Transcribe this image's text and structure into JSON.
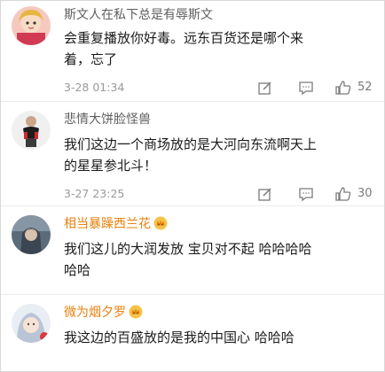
{
  "comments": [
    {
      "username": "斯文人在私下总是有辱斯文",
      "text_line1": "会重复播放你好毒。远东百货还是哪个来",
      "text_line2": "着，忘了",
      "time": "3-28 01:34",
      "likes": "52",
      "vip": false
    },
    {
      "username": "悲情大饼脸怪兽",
      "text_line1": "我们这边一个商场放的是大河向东流啊天上",
      "text_line2": "的星星参北斗！",
      "time": "3-27 23:25",
      "likes": "30",
      "vip": false
    },
    {
      "username": "相当暴躁西兰花",
      "text_line1": "我们这儿的大润发放  宝贝对不起  哈哈哈哈",
      "text_line2": "哈哈",
      "vip": true
    },
    {
      "username": "微为烟夕罗",
      "text_line1": "我这边的百盛放的是我的中国心 哈哈哈",
      "vip": true
    }
  ],
  "icons": {
    "edit": "edit-icon",
    "comment": "comment-icon",
    "like": "thumbs-up-icon",
    "crown": "crown-emoji-icon"
  },
  "colors": {
    "vip_name": "#e8810d",
    "plain_name": "#5e5e5e",
    "meta_gray": "#9a9a9a"
  }
}
